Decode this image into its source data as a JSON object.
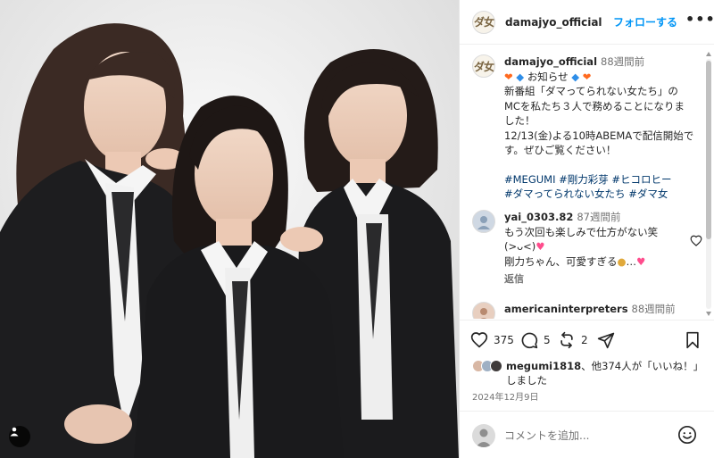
{
  "post": {
    "username": "damajyo_official",
    "follow_label": "フォローする",
    "more_label": "•••",
    "avatar_glyph": "ダ女"
  },
  "caption": {
    "username": "damajyo_official",
    "time": "88週間前",
    "line1_text": "お知らせ",
    "line2": "新番組「ダマってられない女たち」の",
    "line3": "MCを私たち３人で務めることになりま",
    "line4": "した！",
    "line5": "12/13(金)よる10時ABEMAで配信開始で",
    "line6": "す。ぜひご覧ください！",
    "tags1": "#MEGUMI #剛力彩芽 #ヒコロヒー",
    "tags2": "#ダマってられない女たち #ダマ女"
  },
  "comments": [
    {
      "username": "yai_0303.82",
      "time": "87週間前",
      "line1": "もう次回も楽しみで仕方がない笑",
      "line2": "(>ᴗ<)",
      "line3": "剛力ちゃん、可愛すぎる",
      "reply_label": "返信"
    },
    {
      "username": "americaninterpreters",
      "time": "88週間前"
    }
  ],
  "actions": {
    "likes_count": "375",
    "comments_count": "5",
    "reposts_count": "2"
  },
  "likes": {
    "username": "megumi1818",
    "text_mid": "、他374人が「いいね！」",
    "text_end": "しました"
  },
  "date": "2024年12月9日",
  "comment_box": {
    "placeholder": "コメントを追加..."
  },
  "colors": {
    "accent": "#0095f6",
    "hashtag": "#00376b",
    "muted": "#737373"
  }
}
